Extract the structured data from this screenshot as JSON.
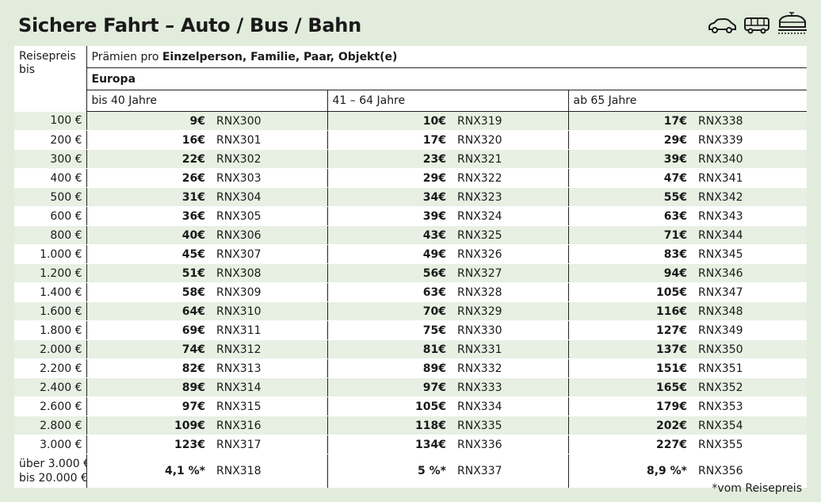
{
  "title": "Sichere Fahrt – Auto / Bus / Bahn",
  "icons": [
    "car-icon",
    "bus-icon",
    "train-icon"
  ],
  "header": {
    "reisepreis_line1": "Reisepreis",
    "reisepreis_line2": "bis",
    "praemien_prefix": "Prämien pro ",
    "praemien_bold": "Einzelperson, Familie, Paar, Objekt(e)",
    "region": "Europa",
    "age_groups": [
      "bis 40 Jahre",
      "41 – 64 Jahre",
      "ab 65 Jahre"
    ]
  },
  "rows": [
    {
      "price": "100 €",
      "v": [
        [
          "9€",
          "RNX300"
        ],
        [
          "10€",
          "RNX319"
        ],
        [
          "17€",
          "RNX338"
        ]
      ]
    },
    {
      "price": "200 €",
      "v": [
        [
          "16€",
          "RNX301"
        ],
        [
          "17€",
          "RNX320"
        ],
        [
          "29€",
          "RNX339"
        ]
      ]
    },
    {
      "price": "300 €",
      "v": [
        [
          "22€",
          "RNX302"
        ],
        [
          "23€",
          "RNX321"
        ],
        [
          "39€",
          "RNX340"
        ]
      ]
    },
    {
      "price": "400 €",
      "v": [
        [
          "26€",
          "RNX303"
        ],
        [
          "29€",
          "RNX322"
        ],
        [
          "47€",
          "RNX341"
        ]
      ]
    },
    {
      "price": "500 €",
      "v": [
        [
          "31€",
          "RNX304"
        ],
        [
          "34€",
          "RNX323"
        ],
        [
          "55€",
          "RNX342"
        ]
      ]
    },
    {
      "price": "600 €",
      "v": [
        [
          "36€",
          "RNX305"
        ],
        [
          "39€",
          "RNX324"
        ],
        [
          "63€",
          "RNX343"
        ]
      ]
    },
    {
      "price": "800 €",
      "v": [
        [
          "40€",
          "RNX306"
        ],
        [
          "43€",
          "RNX325"
        ],
        [
          "71€",
          "RNX344"
        ]
      ]
    },
    {
      "price": "1.000 €",
      "v": [
        [
          "45€",
          "RNX307"
        ],
        [
          "49€",
          "RNX326"
        ],
        [
          "83€",
          "RNX345"
        ]
      ]
    },
    {
      "price": "1.200 €",
      "v": [
        [
          "51€",
          "RNX308"
        ],
        [
          "56€",
          "RNX327"
        ],
        [
          "94€",
          "RNX346"
        ]
      ]
    },
    {
      "price": "1.400 €",
      "v": [
        [
          "58€",
          "RNX309"
        ],
        [
          "63€",
          "RNX328"
        ],
        [
          "105€",
          "RNX347"
        ]
      ]
    },
    {
      "price": "1.600 €",
      "v": [
        [
          "64€",
          "RNX310"
        ],
        [
          "70€",
          "RNX329"
        ],
        [
          "116€",
          "RNX348"
        ]
      ]
    },
    {
      "price": "1.800 €",
      "v": [
        [
          "69€",
          "RNX311"
        ],
        [
          "75€",
          "RNX330"
        ],
        [
          "127€",
          "RNX349"
        ]
      ]
    },
    {
      "price": "2.000 €",
      "v": [
        [
          "74€",
          "RNX312"
        ],
        [
          "81€",
          "RNX331"
        ],
        [
          "137€",
          "RNX350"
        ]
      ]
    },
    {
      "price": "2.200 €",
      "v": [
        [
          "82€",
          "RNX313"
        ],
        [
          "89€",
          "RNX332"
        ],
        [
          "151€",
          "RNX351"
        ]
      ]
    },
    {
      "price": "2.400 €",
      "v": [
        [
          "89€",
          "RNX314"
        ],
        [
          "97€",
          "RNX333"
        ],
        [
          "165€",
          "RNX352"
        ]
      ]
    },
    {
      "price": "2.600 €",
      "v": [
        [
          "97€",
          "RNX315"
        ],
        [
          "105€",
          "RNX334"
        ],
        [
          "179€",
          "RNX353"
        ]
      ]
    },
    {
      "price": "2.800 €",
      "v": [
        [
          "109€",
          "RNX316"
        ],
        [
          "118€",
          "RNX335"
        ],
        [
          "202€",
          "RNX354"
        ]
      ]
    },
    {
      "price": "3.000 €",
      "v": [
        [
          "123€",
          "RNX317"
        ],
        [
          "134€",
          "RNX336"
        ],
        [
          "227€",
          "RNX355"
        ]
      ]
    }
  ],
  "last_row": {
    "price_line1": "über 3.000 €",
    "price_line2": "bis 20.000 €",
    "v": [
      [
        "4,1 %*",
        "RNX318"
      ],
      [
        "5 %*",
        "RNX337"
      ],
      [
        "8,9 %*",
        "RNX356"
      ]
    ]
  },
  "footnote": "*vom Reisepreis"
}
